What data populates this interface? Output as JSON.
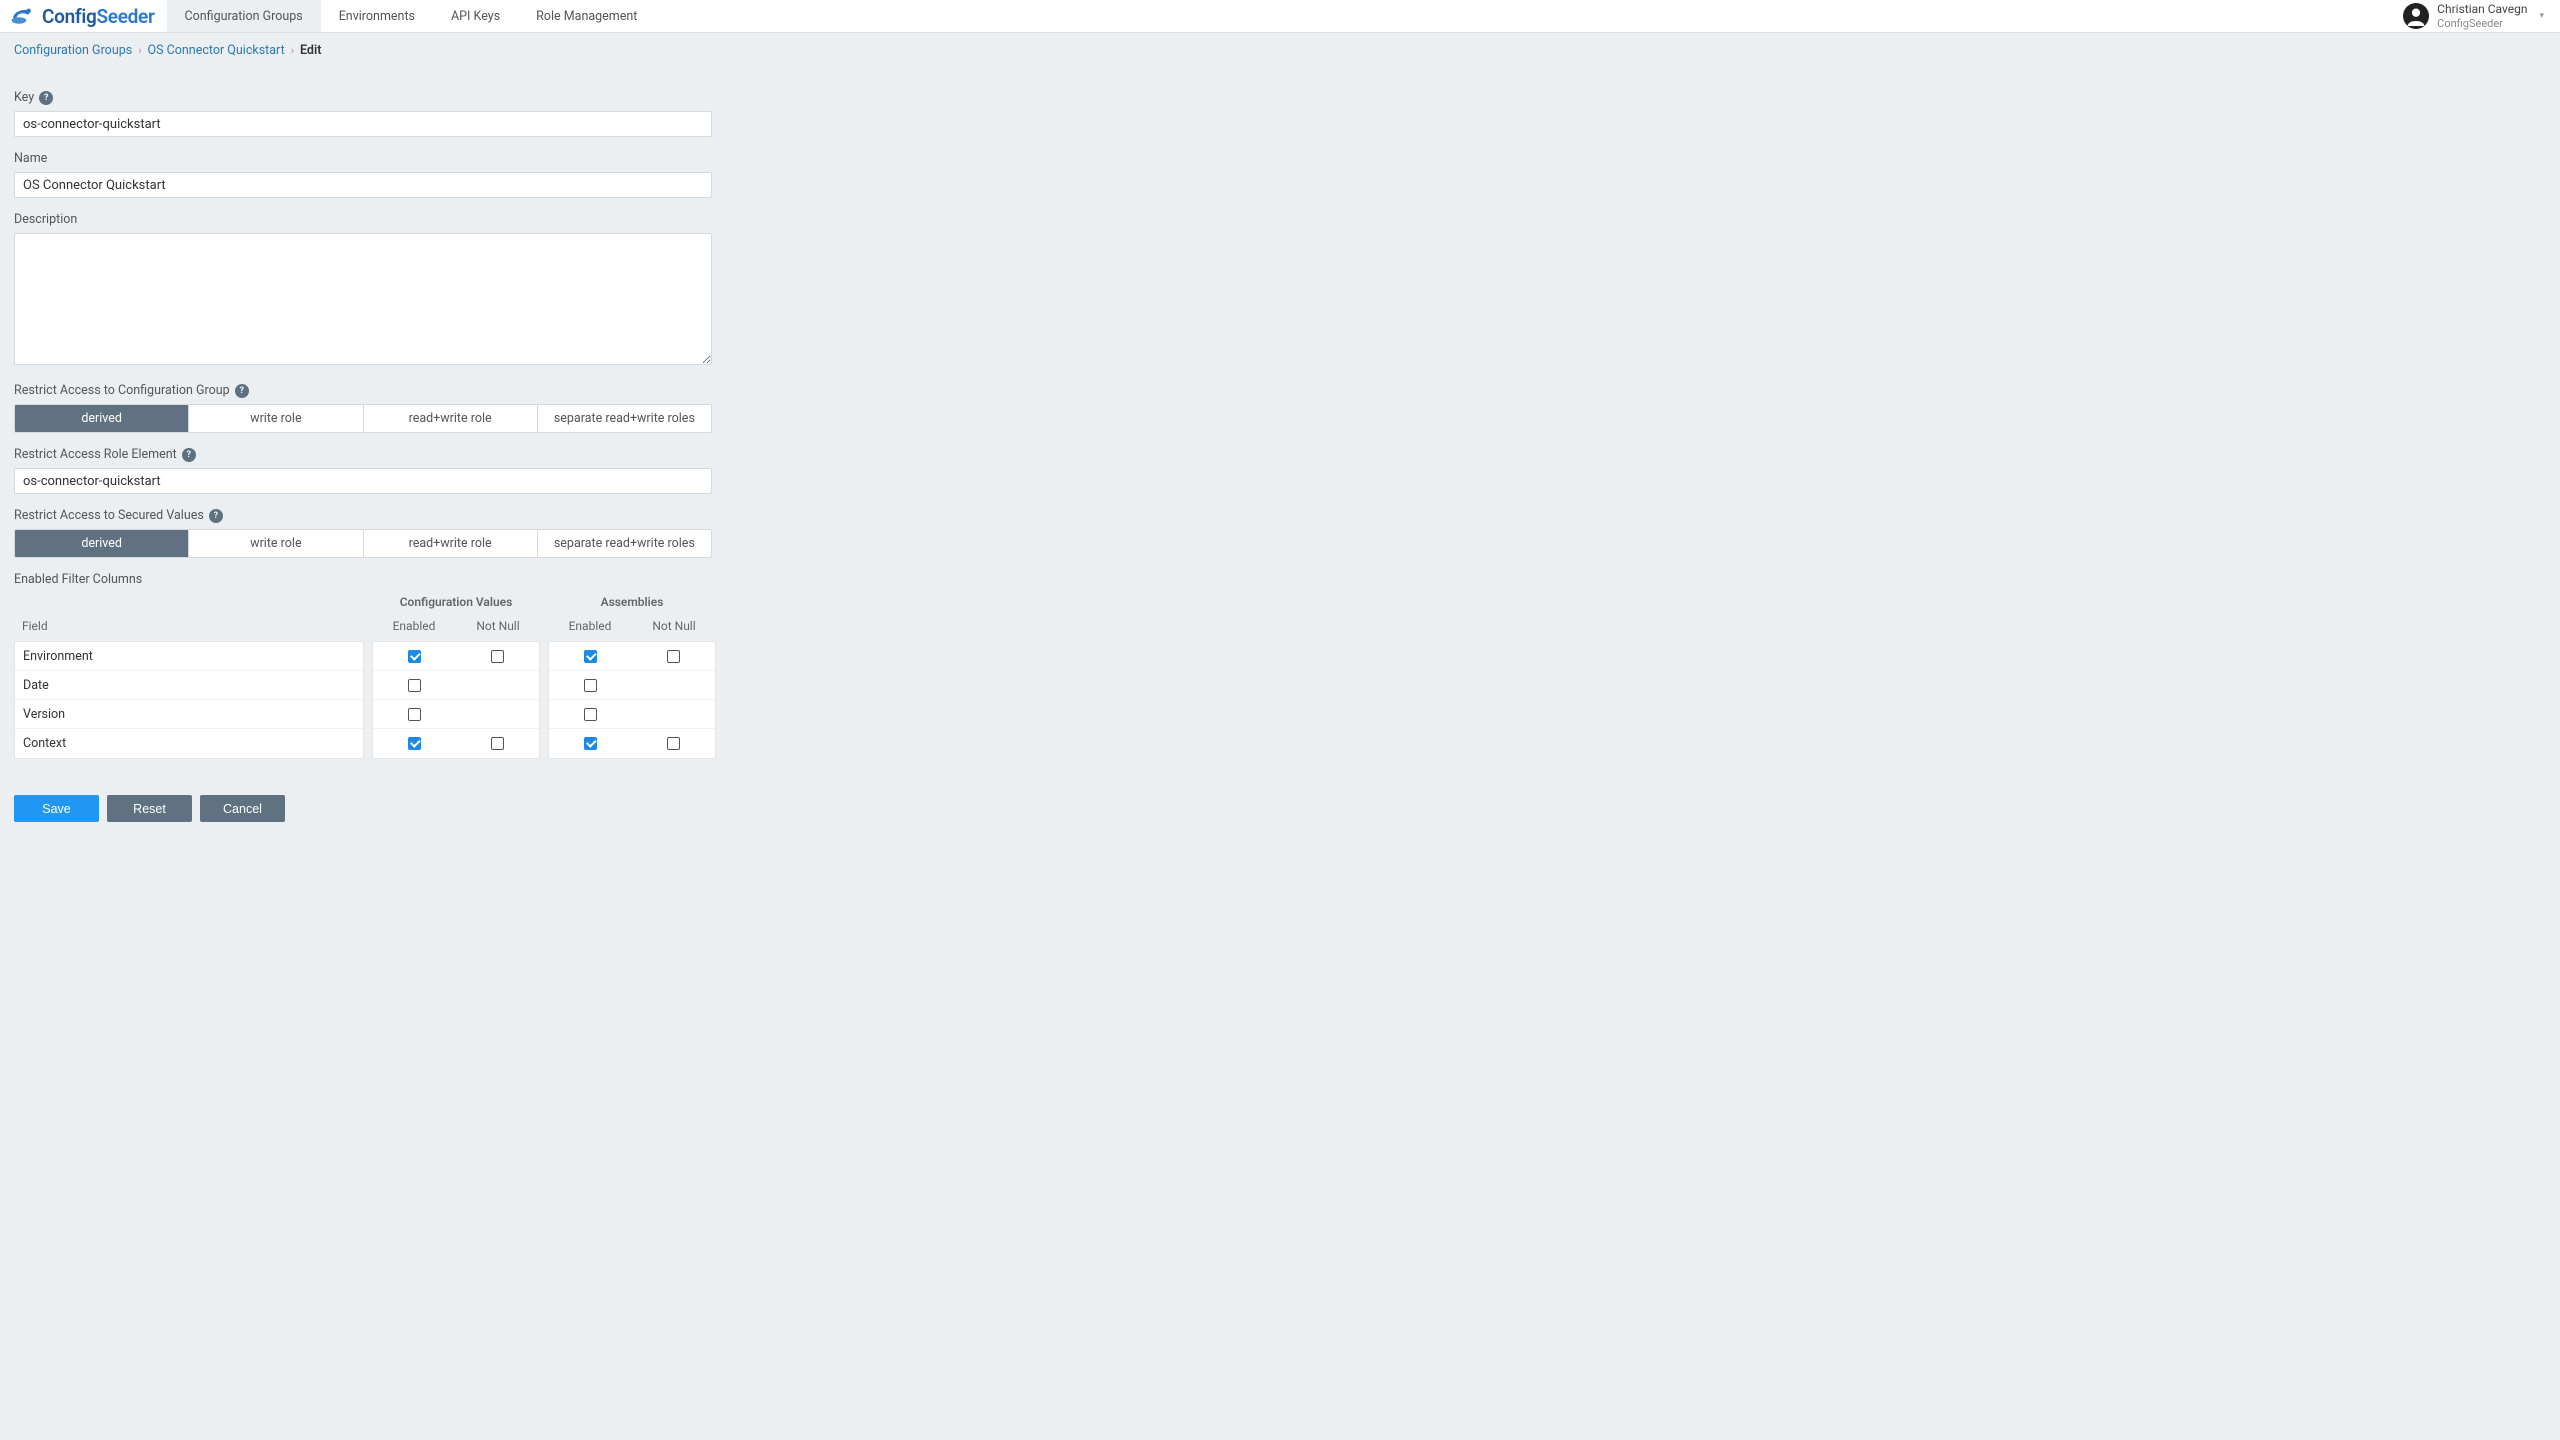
{
  "brand": {
    "config": "Config",
    "seeder": "Seeder"
  },
  "nav": {
    "items": [
      "Configuration Groups",
      "Environments",
      "API Keys",
      "Role Management"
    ],
    "activeIndex": 0
  },
  "user": {
    "name": "Christian Cavegn",
    "org": "ConfigSeeder"
  },
  "breadcrumbs": {
    "items": [
      "Configuration Groups",
      "OS Connector Quickstart"
    ],
    "current": "Edit"
  },
  "form": {
    "keyLabel": "Key",
    "keyValue": "os-connector-quickstart",
    "nameLabel": "Name",
    "nameValue": "OS Connector Quickstart",
    "descLabel": "Description",
    "descValue": "",
    "restrictGroupLabel": "Restrict Access to Configuration Group",
    "roleElementLabel": "Restrict Access Role Element",
    "roleElementValue": "os-connector-quickstart",
    "restrictSecuredLabel": "Restrict Access to Secured Values",
    "segmentOptions": [
      "derived",
      "write role",
      "read+write role",
      "separate read+write roles"
    ],
    "segment1Active": 0,
    "segment2Active": 0
  },
  "filter": {
    "sectionLabel": "Enabled Filter Columns",
    "fieldHeader": "Field",
    "groupHeaders": [
      "Configuration Values",
      "Assemblies"
    ],
    "subHeaders": [
      "Enabled",
      "Not Null"
    ],
    "rows": [
      {
        "field": "Environment",
        "cv_en": true,
        "cv_nn": false,
        "cv_nn_show": true,
        "as_en": true,
        "as_nn": false,
        "as_nn_show": true
      },
      {
        "field": "Date",
        "cv_en": false,
        "cv_nn": false,
        "cv_nn_show": false,
        "as_en": false,
        "as_nn": false,
        "as_nn_show": false
      },
      {
        "field": "Version",
        "cv_en": false,
        "cv_nn": false,
        "cv_nn_show": false,
        "as_en": false,
        "as_nn": false,
        "as_nn_show": false
      },
      {
        "field": "Context",
        "cv_en": true,
        "cv_nn": false,
        "cv_nn_show": true,
        "as_en": true,
        "as_nn": false,
        "as_nn_show": true
      }
    ]
  },
  "actions": {
    "save": "Save",
    "reset": "Reset",
    "cancel": "Cancel"
  }
}
